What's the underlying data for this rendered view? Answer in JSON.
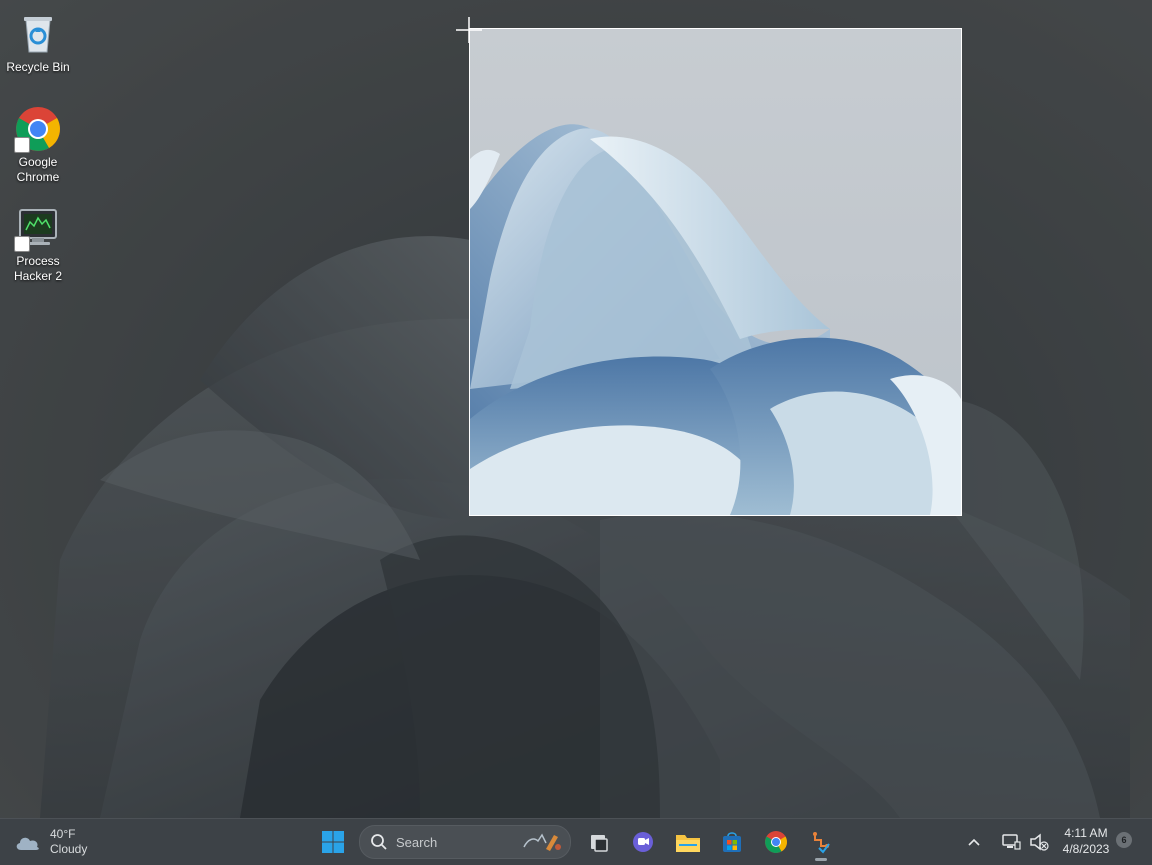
{
  "desktop": {
    "icons": [
      {
        "label": "Recycle Bin",
        "icon": "recycle-bin-icon"
      },
      {
        "label": "Google Chrome",
        "icon": "chrome-icon"
      },
      {
        "label": "Process Hacker 2",
        "icon": "process-hacker-icon"
      }
    ]
  },
  "taskbar": {
    "weather": {
      "temp": "40°F",
      "condition": "Cloudy",
      "icon": "cloud-icon"
    },
    "search": {
      "label": "Search",
      "icon": "search-icon"
    },
    "apps": [
      {
        "name": "Start",
        "icon": "windows-start-icon"
      },
      {
        "name": "Task View",
        "icon": "task-view-icon"
      },
      {
        "name": "Chat",
        "icon": "chat-icon"
      },
      {
        "name": "File Explorer",
        "icon": "file-explorer-icon"
      },
      {
        "name": "Microsoft Store",
        "icon": "store-icon"
      },
      {
        "name": "Google Chrome",
        "icon": "chrome-icon"
      },
      {
        "name": "Snipping Tool",
        "icon": "snipping-tool-icon"
      }
    ],
    "tray": {
      "overflow_icon": "chevron-up-icon",
      "network_icon": "network-icon",
      "volume_icon": "volume-muted-icon",
      "time": "4:11 AM",
      "date": "4/8/2023",
      "notification_count": "6"
    }
  },
  "colors": {
    "taskbar_bg": "#3d4247",
    "windows_blue": "#2aa3e8",
    "chrome_red": "#db4437",
    "chrome_yellow": "#f4b400",
    "chrome_green": "#0f9d58",
    "chrome_blue": "#4285f4"
  }
}
